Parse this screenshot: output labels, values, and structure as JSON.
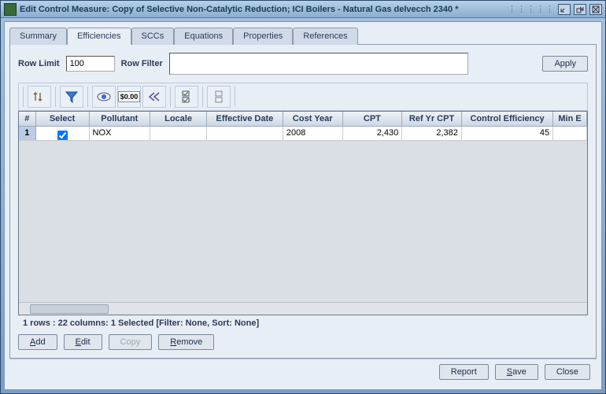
{
  "titlebar": {
    "title": "Edit Control Measure: Copy of Selective Non-Catalytic Reduction; ICI Boilers - Natural Gas delvecch 2340 *"
  },
  "tabs": {
    "summary": "Summary",
    "efficiencies": "Efficiencies",
    "sccs": "SCCs",
    "equations": "Equations",
    "properties": "Properties",
    "references": "References",
    "active": "efficiencies"
  },
  "filter": {
    "row_limit_label": "Row Limit",
    "row_limit_value": "100",
    "row_filter_label": "Row Filter",
    "row_filter_value": "",
    "apply_label": "Apply"
  },
  "toolbar_icons": {
    "sort": "sort-icon",
    "filter": "funnel-icon",
    "view": "eye-icon",
    "format": "currency-icon",
    "first": "rewind-icon",
    "select_all": "check-all-icon",
    "clear": "clear-selection-icon"
  },
  "columns": [
    "#",
    "Select",
    "Pollutant",
    "Locale",
    "Effective Date",
    "Cost Year",
    "CPT",
    "Ref Yr CPT",
    "Control Efficiency",
    "Min E"
  ],
  "rows": [
    {
      "num": "1",
      "select": true,
      "pollutant": "NOX",
      "locale": "",
      "effective_date": "",
      "cost_year": "2008",
      "cpt": "2,430",
      "ref_yr_cpt": "2,382",
      "control_efficiency": "45",
      "min_e": ""
    }
  ],
  "status": "1 rows : 22 columns: 1 Selected [Filter: None, Sort: None]",
  "actions": {
    "add": "Add",
    "edit": "Edit",
    "copy": "Copy",
    "remove": "Remove"
  },
  "bottom": {
    "report": "Report",
    "save": "Save",
    "close": "Close"
  }
}
